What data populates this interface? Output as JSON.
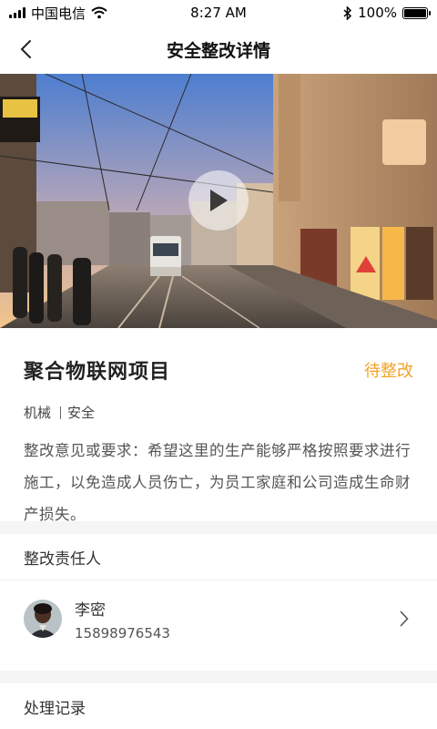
{
  "status_bar": {
    "carrier": "中国电信",
    "time": "8:27 AM",
    "battery_text": "100%",
    "battery_level": 1.0,
    "icons": [
      "signal-icon",
      "wifi-icon",
      "bluetooth-icon",
      "battery-icon"
    ]
  },
  "nav": {
    "title": "安全整改详情",
    "back_icon": "chevron-left-icon"
  },
  "media": {
    "type": "video",
    "play_icon": "play-icon"
  },
  "project": {
    "title": "聚合物联网项目",
    "status": "待整改",
    "status_color": "#f0a32a",
    "tags": [
      "机械",
      "安全"
    ],
    "description": "整改意见或要求：希望这里的生产能够严格按照要求进行施工，以免造成人员伤亡，为员工家庭和公司造成生命财产损失。"
  },
  "responsible": {
    "section_title": "整改责任人",
    "person": {
      "name": "李密",
      "phone": "15898976543"
    }
  },
  "records": {
    "section_title": "处理记录"
  }
}
